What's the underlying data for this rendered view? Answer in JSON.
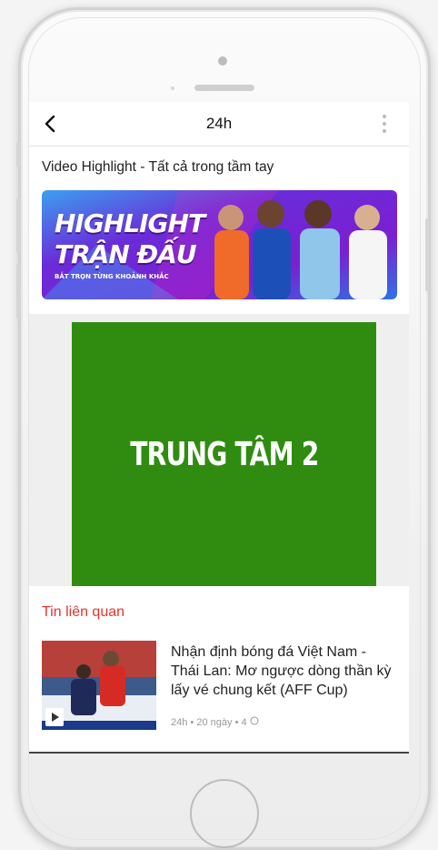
{
  "header": {
    "title": "24h"
  },
  "highlight_section": {
    "heading": "Video Highlight - Tất cả trong tầm tay",
    "banner": {
      "line1": "HIGHLIGHT",
      "line2": "TRẬN ĐẤU",
      "tagline": "BẮT TRỌN TỪNG KHOẢNH KHẮC"
    }
  },
  "ad": {
    "label": "TRUNG TÂM 2",
    "color": "#2f8c10"
  },
  "related": {
    "title": "Tin liên quan",
    "items": [
      {
        "headline": "Nhận định bóng đá Việt Nam - Thái Lan: Mơ ngược dòng thần kỳ lấy vé chung kết (AFF Cup)",
        "source": "24h",
        "age": "20 ngày",
        "comments": "4"
      }
    ]
  },
  "colors": {
    "accent_red": "#e3342f",
    "banner_purple": "#6a2bd9",
    "banner_blue": "#2e73e6"
  },
  "icons": [
    "back-chevron-icon",
    "more-vertical-icon",
    "play-icon",
    "comment-icon"
  ]
}
